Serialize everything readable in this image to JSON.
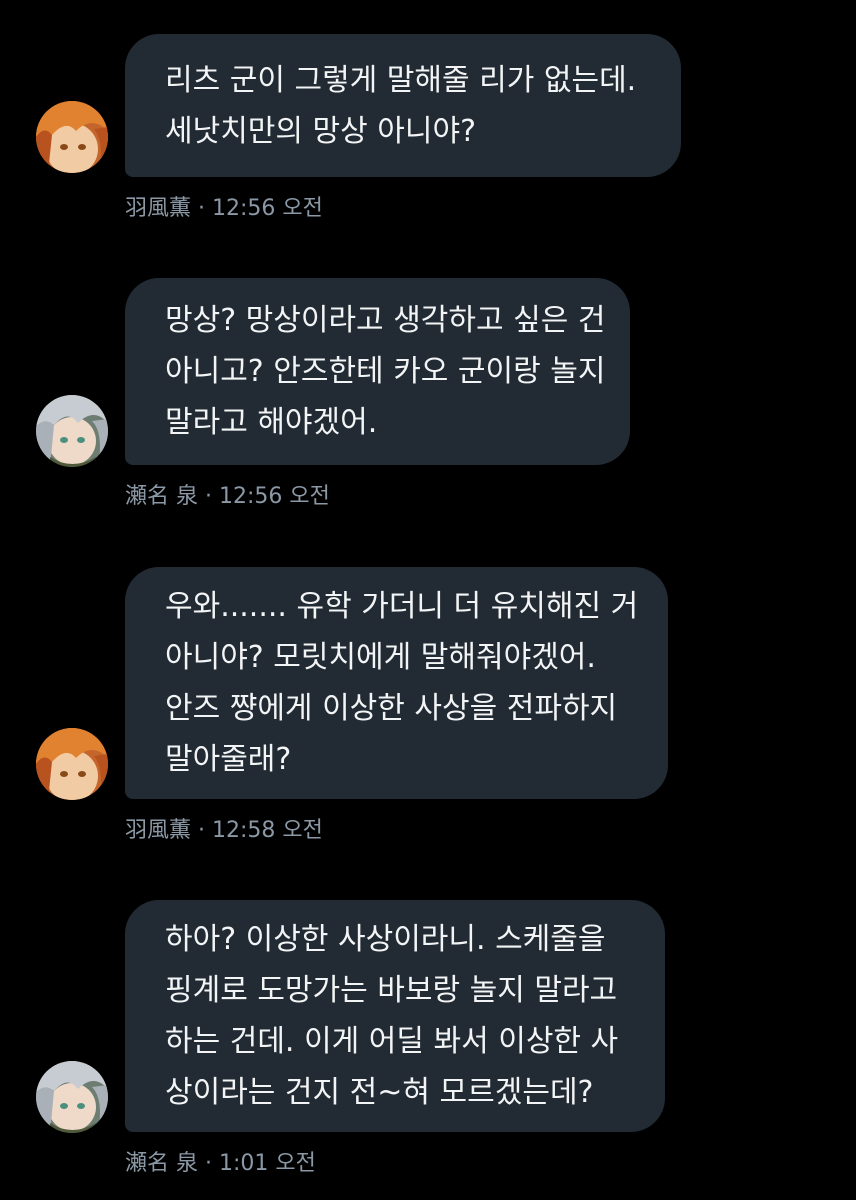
{
  "messages": [
    {
      "sender": "羽風薫",
      "time": "12:56 오전",
      "lines": [
        "리츠 군이 그렇게 말해줄 리가 없는데.",
        "세낫치만의 망상 아니야?"
      ]
    },
    {
      "sender": "瀬名 泉",
      "time": "12:56 오전",
      "lines": [
        "망상?  망상이라고 생각하고 싶은 건",
        "아니고?  안즈한테 카오 군이랑 놀지",
        "말라고 해야겠어."
      ]
    },
    {
      "sender": "羽風薫",
      "time": "12:58 오전",
      "lines": [
        "우와....... 유학 가더니 더 유치해진 거",
        "아니야?  모릿치에게 말해줘야겠어.",
        "안즈 쨩에게 이상한 사상을 전파하지",
        "말아줄래?"
      ]
    },
    {
      "sender": "瀬名 泉",
      "time": "1:01 오전",
      "lines": [
        "하아?  이상한 사상이라니. 스케줄을",
        "핑계로 도망가는 바보랑 놀지 말라고",
        "하는 건데. 이게 어딜 봐서 이상한 사",
        "상이라는 건지 전~혀 모르겠는데?"
      ]
    }
  ],
  "separator": " · ",
  "colors": {
    "background": "#000000",
    "bubble": "#222B33",
    "text": "#F2F4F5",
    "meta": "#8B98A5"
  }
}
